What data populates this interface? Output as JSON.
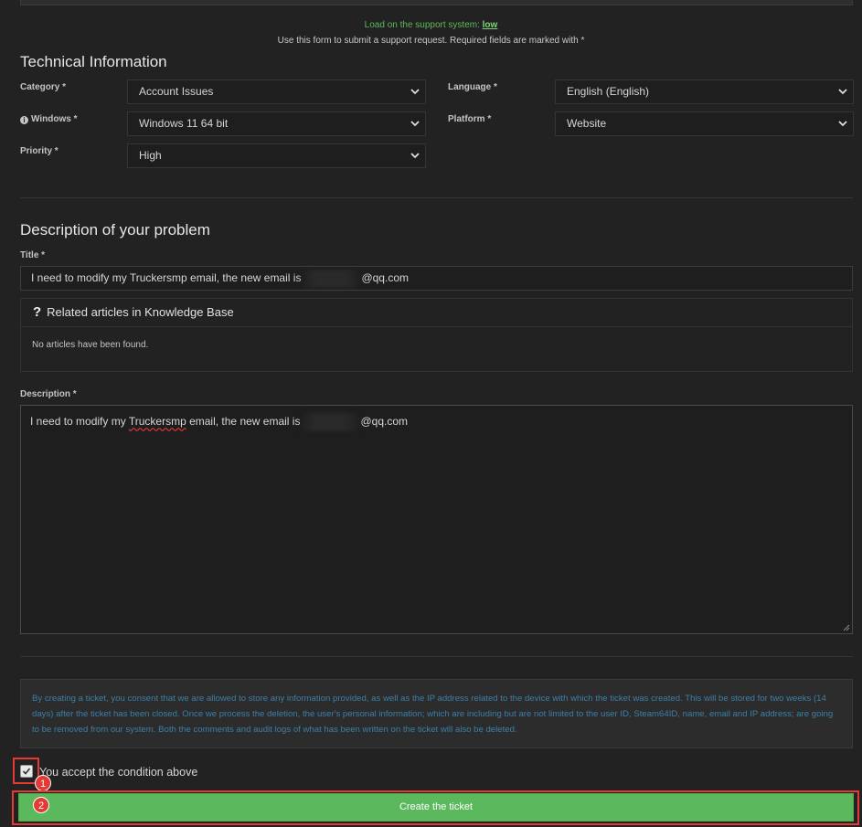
{
  "header": {
    "load_label": "Load on the support system:",
    "load_value": "low",
    "intro": "Use this form to submit a support request. Required fields are marked with *"
  },
  "technical": {
    "heading": "Technical Information",
    "category": {
      "label": "Category *",
      "value": "Account Issues"
    },
    "language": {
      "label": "Language *",
      "value": "English (English)"
    },
    "windows": {
      "label": "Windows *",
      "value": "Windows 11 64 bit",
      "icon": "info-icon"
    },
    "platform": {
      "label": "Platform *",
      "value": "Website"
    },
    "priority": {
      "label": "Priority *",
      "value": "High"
    }
  },
  "problem": {
    "heading": "Description of your problem",
    "title_label": "Title *",
    "title_value_prefix": "I need to modify my Truckersmp email, the new email is",
    "title_value_suffix": "@qq.com",
    "kb": {
      "heading": "Related articles in Knowledge Base",
      "icon": "question-icon",
      "empty_text": "No articles have been found."
    },
    "description_label": "Description *",
    "description_value_prefix": "I need to modify my ",
    "description_misspelled": "Truckersmp",
    "description_value_middle": " email, the new email is",
    "description_value_suffix": "@qq.com"
  },
  "consent": {
    "notice": "By creating a ticket, you consent that we are allowed to store any information provided, as well as the IP address related to the device with which the ticket was created. This will be stored for two weeks (14 days) after the ticket has been closed. Once we process the deletion, the user's personal information; which are including but are not limited to the user ID, Steam64ID, name, email and IP address; are going to be removed from our system. Both the comments and audit logs of what has been written on the ticket will also be deleted.",
    "accept_label": "You accept the condition above",
    "checked": true
  },
  "submit_label": "Create the ticket",
  "annotations": {
    "badge_1": "1",
    "badge_2": "2"
  },
  "colors": {
    "accent_green": "#5cb85c",
    "highlight_red": "#e53935",
    "notice_text": "#3d7fa8"
  }
}
